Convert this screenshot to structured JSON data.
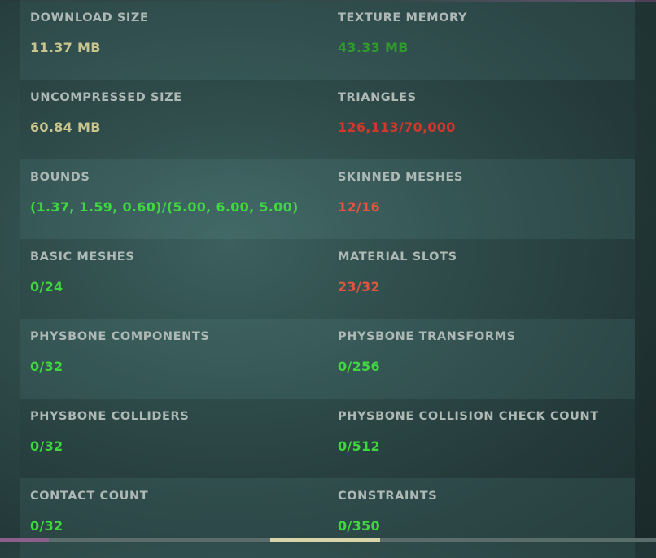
{
  "stats": [
    {
      "left": {
        "label": "DOWNLOAD SIZE",
        "value": "11.37 MB",
        "status": "neutral"
      },
      "right": {
        "label": "TEXTURE MEMORY",
        "value": "43.33 MB",
        "status": "good-dim"
      }
    },
    {
      "left": {
        "label": "UNCOMPRESSED SIZE",
        "value": "60.84 MB",
        "status": "neutral"
      },
      "right": {
        "label": "TRIANGLES",
        "value": "126,113/70,000",
        "status": "bad"
      }
    },
    {
      "left": {
        "label": "BOUNDS",
        "value": "(1.37, 1.59, 0.60)/(5.00, 6.00, 5.00)",
        "status": "good"
      },
      "right": {
        "label": "SKINNED MESHES",
        "value": "12/16",
        "status": "warn"
      }
    },
    {
      "left": {
        "label": "BASIC MESHES",
        "value": "0/24",
        "status": "good"
      },
      "right": {
        "label": "MATERIAL SLOTS",
        "value": "23/32",
        "status": "warn"
      }
    },
    {
      "left": {
        "label": "PHYSBONE COMPONENTS",
        "value": "0/32",
        "status": "good"
      },
      "right": {
        "label": "PHYSBONE TRANSFORMS",
        "value": "0/256",
        "status": "good"
      }
    },
    {
      "left": {
        "label": "PHYSBONE COLLIDERS",
        "value": "0/32",
        "status": "good"
      },
      "right": {
        "label": "PHYSBONE COLLISION CHECK COUNT",
        "value": "0/512",
        "status": "good"
      }
    },
    {
      "left": {
        "label": "CONTACT COUNT",
        "value": "0/32",
        "status": "good"
      },
      "right": {
        "label": "CONSTRAINTS",
        "value": "0/350",
        "status": "good"
      }
    }
  ],
  "colors": {
    "neutral": "#c8c58f",
    "good": "#3fd63f",
    "good-dim": "#2f9a2f",
    "bad": "#d3362a",
    "warn": "#e2543f",
    "label": "#aeb8b4"
  }
}
